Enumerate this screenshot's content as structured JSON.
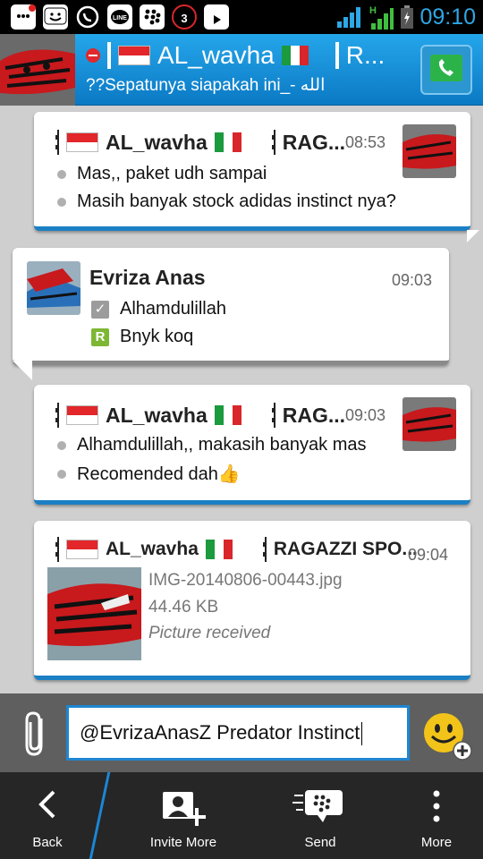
{
  "status_bar": {
    "time": "09:10",
    "notification_icons": [
      "bbm-icon",
      "bbm-chat-icon",
      "whatsapp-icon",
      "line-icon",
      "blackberry-icon",
      "badge-icon",
      "play-store-icon"
    ],
    "badge_count": "3",
    "line_label": "LINE"
  },
  "header": {
    "contact_name": "AL_wavha",
    "contact_suffix": "R...",
    "status_message": "??Sepatunya siapakah ini_- الله"
  },
  "messages": [
    {
      "sender": "AL_wavha",
      "sender_suffix": "RAG...",
      "time": "08:53",
      "lines": [
        "Mas,, paket udh sampai",
        "Masih banyak stock adidas instinct nya?"
      ]
    },
    {
      "sender": "Evriza Anas",
      "time": "09:03",
      "lines": [
        "Alhamdulillah",
        "Bnyk koq"
      ],
      "line_markers": [
        "✓",
        "R"
      ]
    },
    {
      "sender": "AL_wavha",
      "sender_suffix": "RAG...",
      "time": "09:03",
      "lines": [
        "Alhamdulillah,, makasih banyak mas",
        "Recomended dah👍"
      ]
    },
    {
      "sender": "AL_wavha",
      "sender_suffix": "RAGAZZI SPO...",
      "time": "09:04",
      "file_name": "IMG-20140806-00443.jpg",
      "file_size": "44.46 KB",
      "file_status": "Picture received"
    }
  ],
  "composer": {
    "text": "@EvrizaAnasZ Predator Instinct"
  },
  "actions": {
    "back": "Back",
    "invite_more": "Invite More",
    "send": "Send",
    "more": "More"
  },
  "colors": {
    "header_blue": "#1a8fdc",
    "my_message_accent": "#1b7fc4",
    "their_message_accent": "#8a8a8a",
    "status_time": "#2ea7e6"
  }
}
